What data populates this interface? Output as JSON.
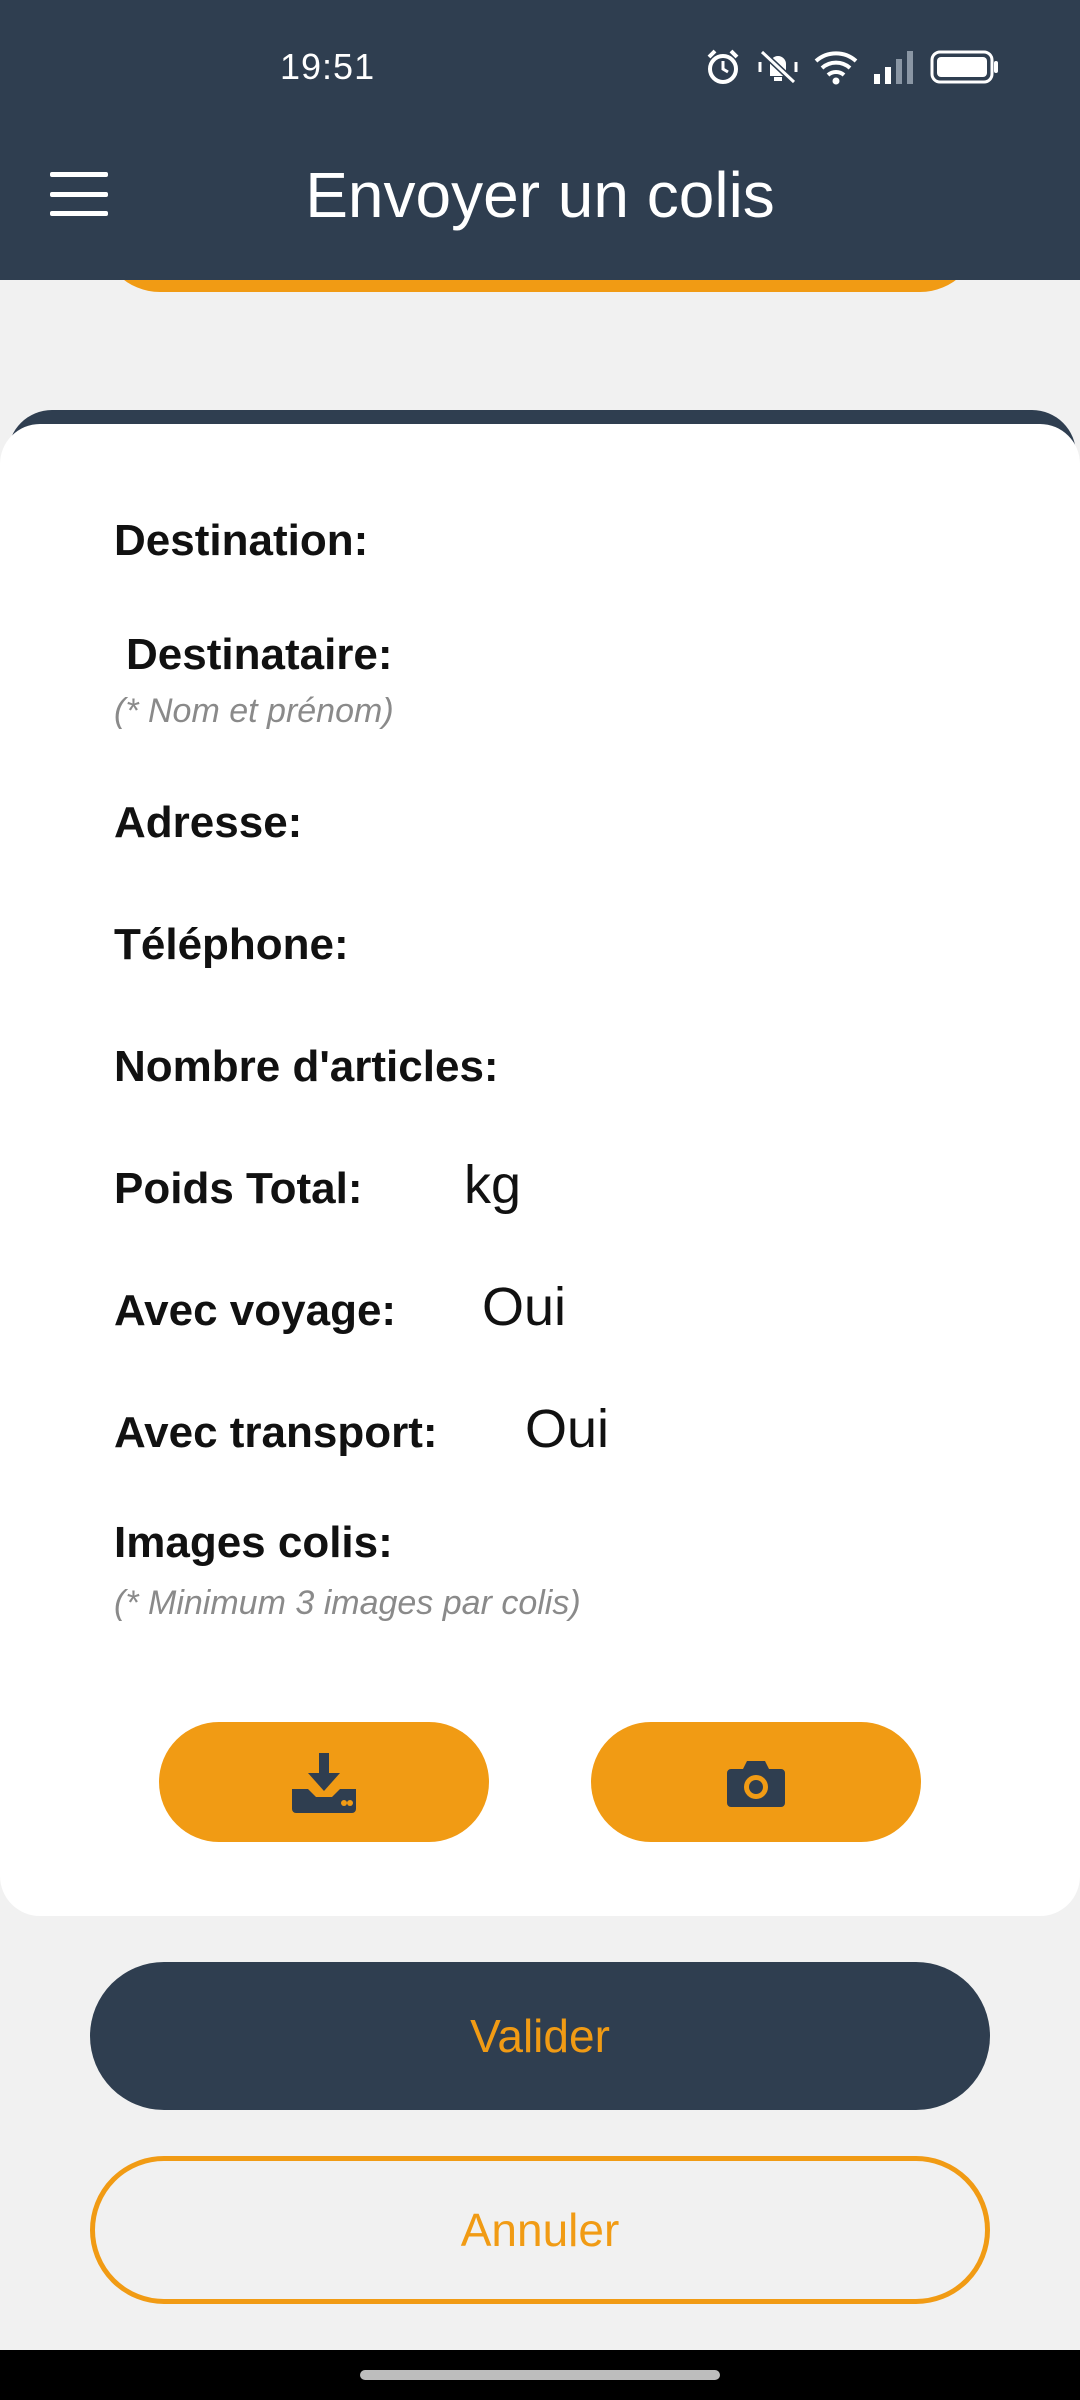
{
  "status_bar": {
    "time": "19:51",
    "icons": [
      "alarm-icon",
      "vibrate-muted-icon",
      "wifi-icon",
      "signal-icon",
      "battery-icon"
    ]
  },
  "header": {
    "title": "Envoyer un colis",
    "menu_icon": "menu-icon"
  },
  "form": {
    "destination_label": "Destination:",
    "recipient_label": "Destinataire:",
    "recipient_hint": "(* Nom et prénom)",
    "address_label": "Adresse:",
    "phone_label": "Téléphone:",
    "items_label": "Nombre d'articles:",
    "weight_label": "Poids Total:",
    "weight_unit": "kg",
    "with_trip_label": "Avec voyage:",
    "with_trip_value": "Oui",
    "with_transport_label": "Avec transport:",
    "with_transport_value": "Oui",
    "images_label": "Images colis:",
    "images_hint": "(* Minimum 3 images par colis)",
    "upload_icon": "download-tray-icon",
    "camera_icon": "camera-icon"
  },
  "actions": {
    "validate_label": "Valider",
    "cancel_label": "Annuler"
  },
  "colors": {
    "primary_dark": "#2f3e50",
    "accent_orange": "#f19b14",
    "background": "#f1f1f1",
    "card": "#ffffff",
    "hint_grey": "#8a8a8a"
  }
}
